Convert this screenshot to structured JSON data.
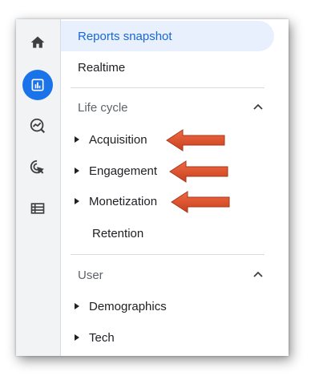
{
  "rail": {
    "items": [
      {
        "icon": "home-icon",
        "active": false
      },
      {
        "icon": "reports-icon",
        "active": true
      },
      {
        "icon": "explore-icon",
        "active": false
      },
      {
        "icon": "advertising-icon",
        "active": false
      },
      {
        "icon": "configure-icon",
        "active": false
      }
    ]
  },
  "nav": {
    "reports_snapshot": "Reports snapshot",
    "realtime": "Realtime",
    "life_cycle": {
      "title": "Life cycle",
      "items": [
        "Acquisition",
        "Engagement",
        "Monetization",
        "Retention"
      ]
    },
    "user": {
      "title": "User",
      "items": [
        "Demographics",
        "Tech"
      ]
    }
  },
  "colors": {
    "accent": "#1a73e8",
    "selected_bg": "#e8f0fe",
    "selected_text": "#1967d2",
    "annotation_arrow": "#d9502c"
  }
}
